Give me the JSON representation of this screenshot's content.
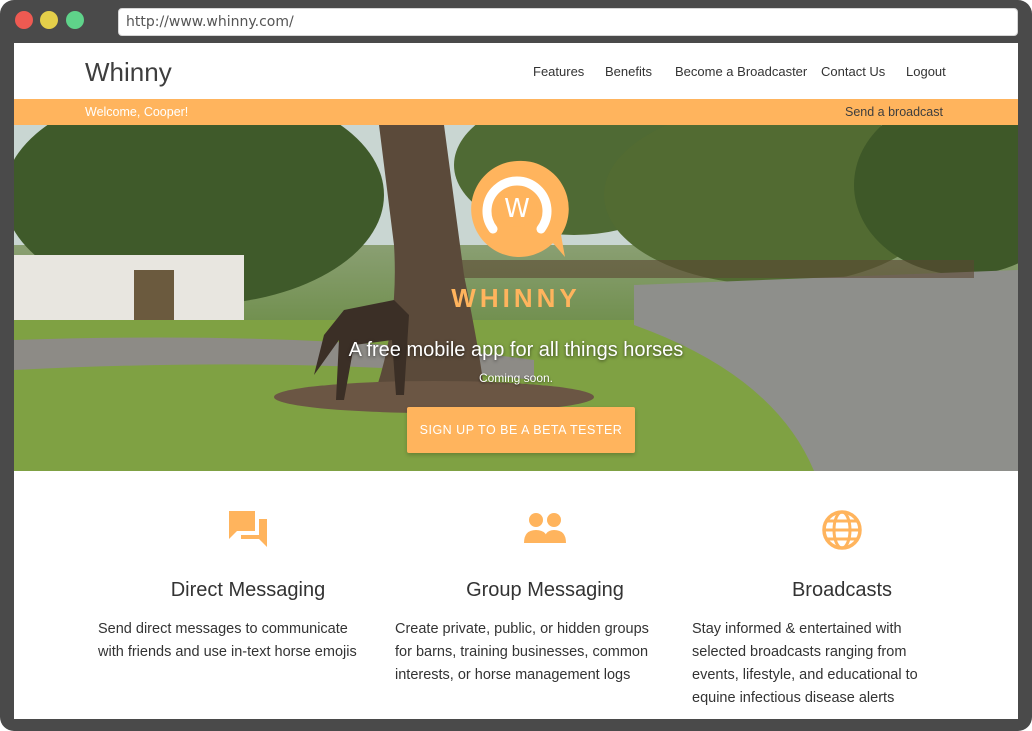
{
  "browser": {
    "url": "http://www.whinny.com/"
  },
  "header": {
    "brand": "Whinny",
    "nav": [
      "Features",
      "Benefits",
      "Become a Broadcaster",
      "Contact Us",
      "Logout"
    ]
  },
  "welcome_bar": {
    "greeting": "Welcome, Cooper!",
    "action": "Send a broadcast"
  },
  "hero": {
    "logo_letter": "W",
    "brand": "WHINNY",
    "tagline": "A free mobile app for all things horses",
    "subtext": "Coming soon.",
    "cta_label": "SIGN UP TO BE A BETA TESTER"
  },
  "features": [
    {
      "icon": "chat-bubbles-icon",
      "title": "Direct Messaging",
      "description": "Send direct messages to communicate with friends and use in-text horse emojis"
    },
    {
      "icon": "group-icon",
      "title": "Group Messaging",
      "description": "Create private, public, or hidden groups for barns, training businesses, common interests, or horse management logs"
    },
    {
      "icon": "globe-icon",
      "title": "Broadcasts",
      "description": "Stay informed & entertained with selected broadcasts ranging from events, lifestyle, and educational to equine infectious disease alerts"
    }
  ],
  "colors": {
    "accent": "#ffb45d",
    "text": "#333333",
    "frame": "#4a4a4a"
  }
}
